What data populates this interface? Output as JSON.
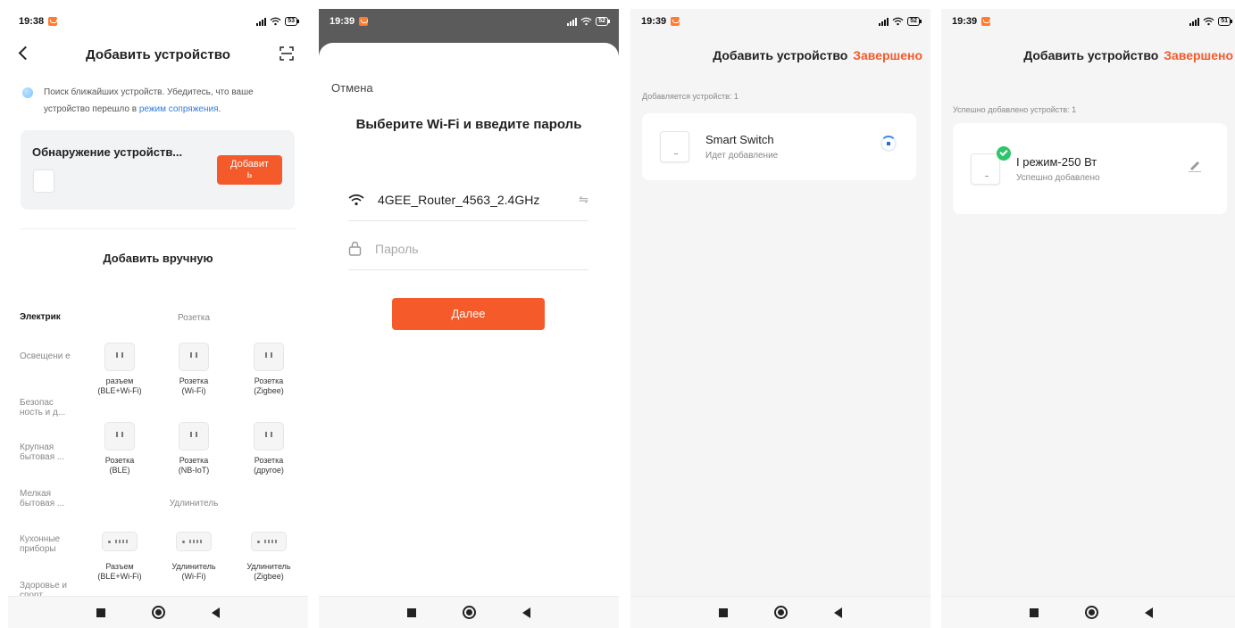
{
  "screens": [
    {
      "status": {
        "time": "19:38",
        "battery": "53"
      },
      "header": {
        "title": "Добавить устройство"
      },
      "search_notice": {
        "text": "Поиск ближайших устройств. Убедитесь, что ваше устройство перешло в",
        "link": "режим сопряжения",
        "tail": "."
      },
      "discovery": {
        "title": "Обнаружение устройств...",
        "add_label_1": "Добавит",
        "add_label_2": "ь"
      },
      "manual_title": "Добавить вручную",
      "categories": [
        {
          "label": "Электрик",
          "active": true
        },
        {
          "label": "Освещени е"
        },
        {
          "label": "Безопас ность и д..."
        },
        {
          "label": "Крупная бытовая ..."
        },
        {
          "label": "Мелкая бытовая ..."
        },
        {
          "label": "Кухонные приборы"
        },
        {
          "label": "Здоровье и спорт"
        }
      ],
      "sections": [
        {
          "title": "Розетка",
          "devices": [
            {
              "l1": "разъем",
              "l2": "(BLE+Wi-Fi)"
            },
            {
              "l1": "Розетка",
              "l2": "(Wi-Fi)"
            },
            {
              "l1": "Розетка",
              "l2": "(Zigbee)"
            },
            {
              "l1": "Розетка",
              "l2": "(BLE)"
            },
            {
              "l1": "Розетка",
              "l2": "(NB-IoT)"
            },
            {
              "l1": "Розетка",
              "l2": "(другое)"
            }
          ]
        },
        {
          "title": "Удлинитель",
          "devices": [
            {
              "l1": "Разъем",
              "l2": "(BLE+Wi-Fi)"
            },
            {
              "l1": "Удлинитель",
              "l2": "(Wi-Fi)"
            },
            {
              "l1": "Удлинитель",
              "l2": "(Zigbee)"
            }
          ]
        }
      ]
    },
    {
      "status": {
        "time": "19:39",
        "battery": "52"
      },
      "cancel": "Отмена",
      "title": "Выберите Wi-Fi и введите пароль",
      "ssid": "4GEE_Router_4563_2.4GHz",
      "password_placeholder": "Пароль",
      "swap_glyph": "⇋",
      "next": "Далее"
    },
    {
      "status": {
        "time": "19:39",
        "battery": "52"
      },
      "header": {
        "title": "Добавить устройство",
        "done": "Завершено"
      },
      "count_label": "Добавляется устройств: 1",
      "device": {
        "name": "Smart Switch",
        "status": "Идет добавление"
      }
    },
    {
      "status": {
        "time": "19:39",
        "battery": "51"
      },
      "header": {
        "title": "Добавить устройство",
        "done": "Завершено"
      },
      "count_label": "Успешно добавлено устройств: 1",
      "device": {
        "name": "І режим-250 Вт",
        "status": "Успешно добавлено"
      }
    }
  ],
  "colors": {
    "accent": "#f45a2a",
    "link": "#2f7de1",
    "success": "#2ec56b"
  }
}
